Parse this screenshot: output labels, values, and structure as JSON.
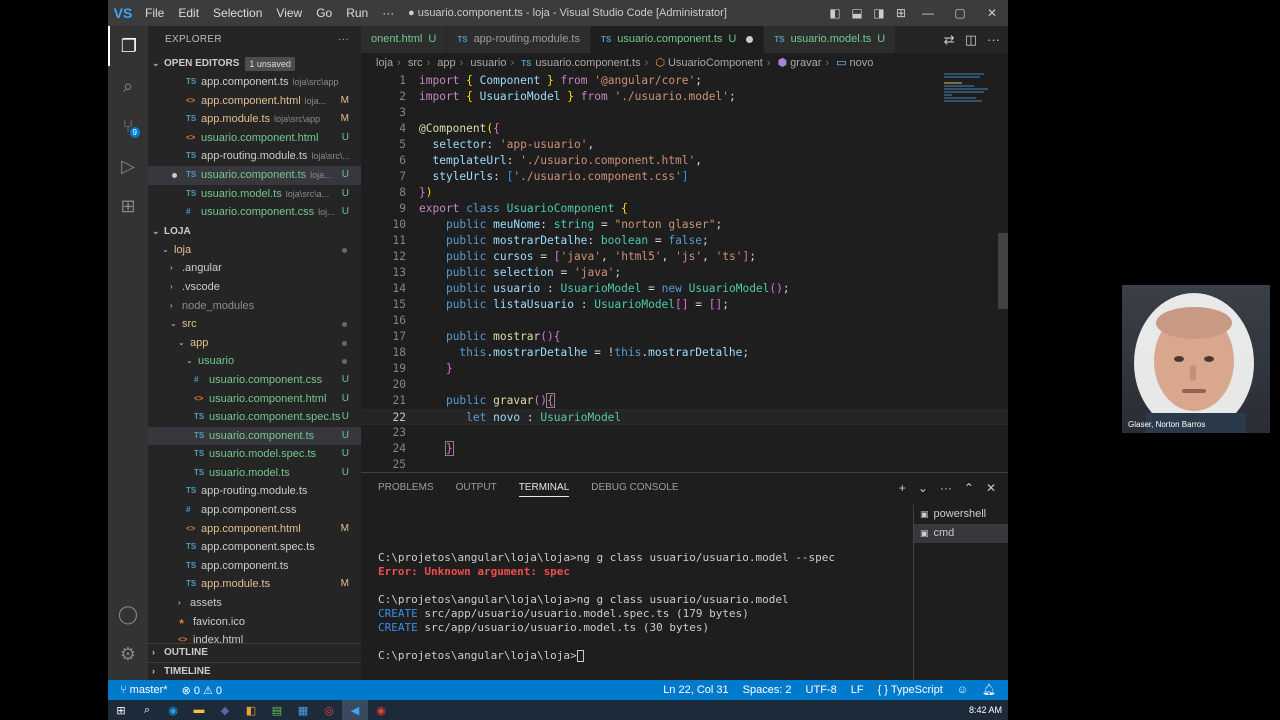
{
  "titlebar": {
    "logo": "VS",
    "menu": [
      "File",
      "Edit",
      "Selection",
      "View",
      "Go",
      "Run",
      "···"
    ],
    "window_title": "● usuario.component.ts - loja - Visual Studio Code [Administrator]",
    "window_controls": [
      "—",
      "▢",
      "✕"
    ]
  },
  "sidebar": {
    "header": "EXPLORER",
    "more": "···",
    "open_editors": {
      "label": "OPEN EDITORS",
      "unsaved": "1 unsaved",
      "items": [
        {
          "icon": "TS",
          "type": "ts",
          "name": "app.component.ts",
          "path": "loja\\src\\app",
          "status": ""
        },
        {
          "icon": "<>",
          "type": "html",
          "name": "app.component.html",
          "path": "loja...",
          "status": "M"
        },
        {
          "icon": "TS",
          "type": "ts",
          "name": "app.module.ts",
          "path": "loja\\src\\app",
          "status": "M"
        },
        {
          "icon": "<>",
          "type": "html",
          "name": "usuario.component.html",
          "path": "",
          "status": "U"
        },
        {
          "icon": "TS",
          "type": "ts",
          "name": "app-routing.module.ts",
          "path": "loja\\src\\...",
          "status": ""
        },
        {
          "icon": "TS",
          "type": "ts",
          "name": "usuario.component.ts",
          "path": "loja...",
          "status": "U"
        },
        {
          "icon": "TS",
          "type": "ts",
          "name": "usuario.model.ts",
          "path": "loja\\src\\a...",
          "status": "U"
        },
        {
          "icon": "#",
          "type": "css",
          "name": "usuario.component.css",
          "path": "loj...",
          "status": "U"
        }
      ]
    },
    "folder": {
      "label": "LOJA",
      "items": [
        {
          "depth": 1,
          "twisty": "⌄",
          "name": "loja",
          "color": "m",
          "dot": true
        },
        {
          "depth": 2,
          "twisty": "›",
          "name": ".angular",
          "color": "n",
          "dot": false
        },
        {
          "depth": 2,
          "twisty": "›",
          "name": ".vscode",
          "color": "n",
          "dot": false
        },
        {
          "depth": 2,
          "twisty": "›",
          "name": "node_modules",
          "color": "dim",
          "dot": false
        },
        {
          "depth": 2,
          "twisty": "⌄",
          "name": "src",
          "color": "m",
          "dot": true
        },
        {
          "depth": 3,
          "twisty": "⌄",
          "name": "app",
          "color": "m",
          "dot": true
        },
        {
          "depth": 4,
          "twisty": "⌄",
          "name": "usuario",
          "color": "u",
          "dot": true
        },
        {
          "depth": 5,
          "icon": "#",
          "type": "css",
          "name": "usuario.component.css",
          "color": "u",
          "status": "U"
        },
        {
          "depth": 5,
          "icon": "<>",
          "type": "html",
          "name": "usuario.component.html",
          "color": "u",
          "status": "U"
        },
        {
          "depth": 5,
          "icon": "TS",
          "type": "ts",
          "name": "usuario.component.spec.ts",
          "color": "u",
          "status": "U"
        },
        {
          "depth": 5,
          "icon": "TS",
          "type": "ts",
          "name": "usuario.component.ts",
          "color": "u",
          "status": "U",
          "selected": true
        },
        {
          "depth": 5,
          "icon": "TS",
          "type": "ts",
          "name": "usuario.model.spec.ts",
          "color": "u",
          "status": "U"
        },
        {
          "depth": 5,
          "icon": "TS",
          "type": "ts",
          "name": "usuario.model.ts",
          "color": "u",
          "status": "U"
        },
        {
          "depth": 4,
          "icon": "TS",
          "type": "ts",
          "name": "app-routing.module.ts",
          "color": "n",
          "status": ""
        },
        {
          "depth": 4,
          "icon": "#",
          "type": "css",
          "name": "app.component.css",
          "color": "n",
          "status": ""
        },
        {
          "depth": 4,
          "icon": "<>",
          "type": "html",
          "name": "app.component.html",
          "color": "m",
          "status": "M"
        },
        {
          "depth": 4,
          "icon": "TS",
          "type": "ts",
          "name": "app.component.spec.ts",
          "color": "n",
          "status": ""
        },
        {
          "depth": 4,
          "icon": "TS",
          "type": "ts",
          "name": "app.component.ts",
          "color": "n",
          "status": ""
        },
        {
          "depth": 4,
          "icon": "TS",
          "type": "ts",
          "name": "app.module.ts",
          "color": "m",
          "status": "M"
        },
        {
          "depth": 3,
          "twisty": "›",
          "name": "assets",
          "color": "n",
          "dot": false
        },
        {
          "depth": 3,
          "icon": "★",
          "type": "html",
          "name": "favicon.ico",
          "color": "n",
          "status": ""
        },
        {
          "depth": 3,
          "icon": "<>",
          "type": "html",
          "name": "index.html",
          "color": "n",
          "status": ""
        }
      ]
    },
    "outline": "OUTLINE",
    "timeline": "TIMELINE"
  },
  "editor": {
    "tabs": [
      {
        "icon": "",
        "label": "onent.html",
        "mark": "U",
        "active": false
      },
      {
        "icon": "TS",
        "label": "app-routing.module.ts",
        "mark": "",
        "active": false
      },
      {
        "icon": "TS",
        "label": "usuario.component.ts",
        "mark": "U",
        "active": true,
        "dirty": true
      },
      {
        "icon": "TS",
        "label": "usuario.model.ts",
        "mark": "U",
        "active": false
      }
    ],
    "breadcrumb": [
      "loja",
      "src",
      "app",
      "usuario",
      "usuario.component.ts",
      "UsuarioComponent",
      "gravar",
      "novo"
    ],
    "cursor_line": 22
  },
  "panel": {
    "tabs": [
      "PROBLEMS",
      "OUTPUT",
      "TERMINAL",
      "DEBUG CONSOLE"
    ],
    "active_tab": "TERMINAL",
    "terminal_lines": [
      {
        "kind": "",
        "text": ""
      },
      {
        "kind": "",
        "text": "C:\\projetos\\angular\\loja\\loja>ng g class usuario/usuario.model --spec"
      },
      {
        "kind": "err",
        "text": "Error: Unknown argument: spec"
      },
      {
        "kind": "",
        "text": ""
      },
      {
        "kind": "",
        "text": "C:\\projetos\\angular\\loja\\loja>ng g class usuario/usuario.model"
      },
      {
        "kind": "create",
        "prefix": "CREATE",
        "text": " src/app/usuario/usuario.model.spec.ts (179 bytes)"
      },
      {
        "kind": "create",
        "prefix": "CREATE",
        "text": " src/app/usuario/usuario.model.ts (30 bytes)"
      },
      {
        "kind": "",
        "text": ""
      },
      {
        "kind": "prompt",
        "text": "C:\\projetos\\angular\\loja\\loja>"
      }
    ],
    "terminals": [
      {
        "icon": "▣",
        "name": "powershell",
        "selected": false
      },
      {
        "icon": "▣",
        "name": "cmd",
        "selected": true
      }
    ]
  },
  "statusbar": {
    "branch": "master*",
    "problems": "⊗ 0 ⚠ 0",
    "position": "Ln 22, Col 31",
    "spaces": "Spaces: 2",
    "encoding": "UTF-8",
    "eol": "LF",
    "language": "TypeScript"
  },
  "taskbar": {
    "clock": "8:42 AM"
  },
  "webcam": {
    "name": "Glaser, Norton Barros"
  }
}
